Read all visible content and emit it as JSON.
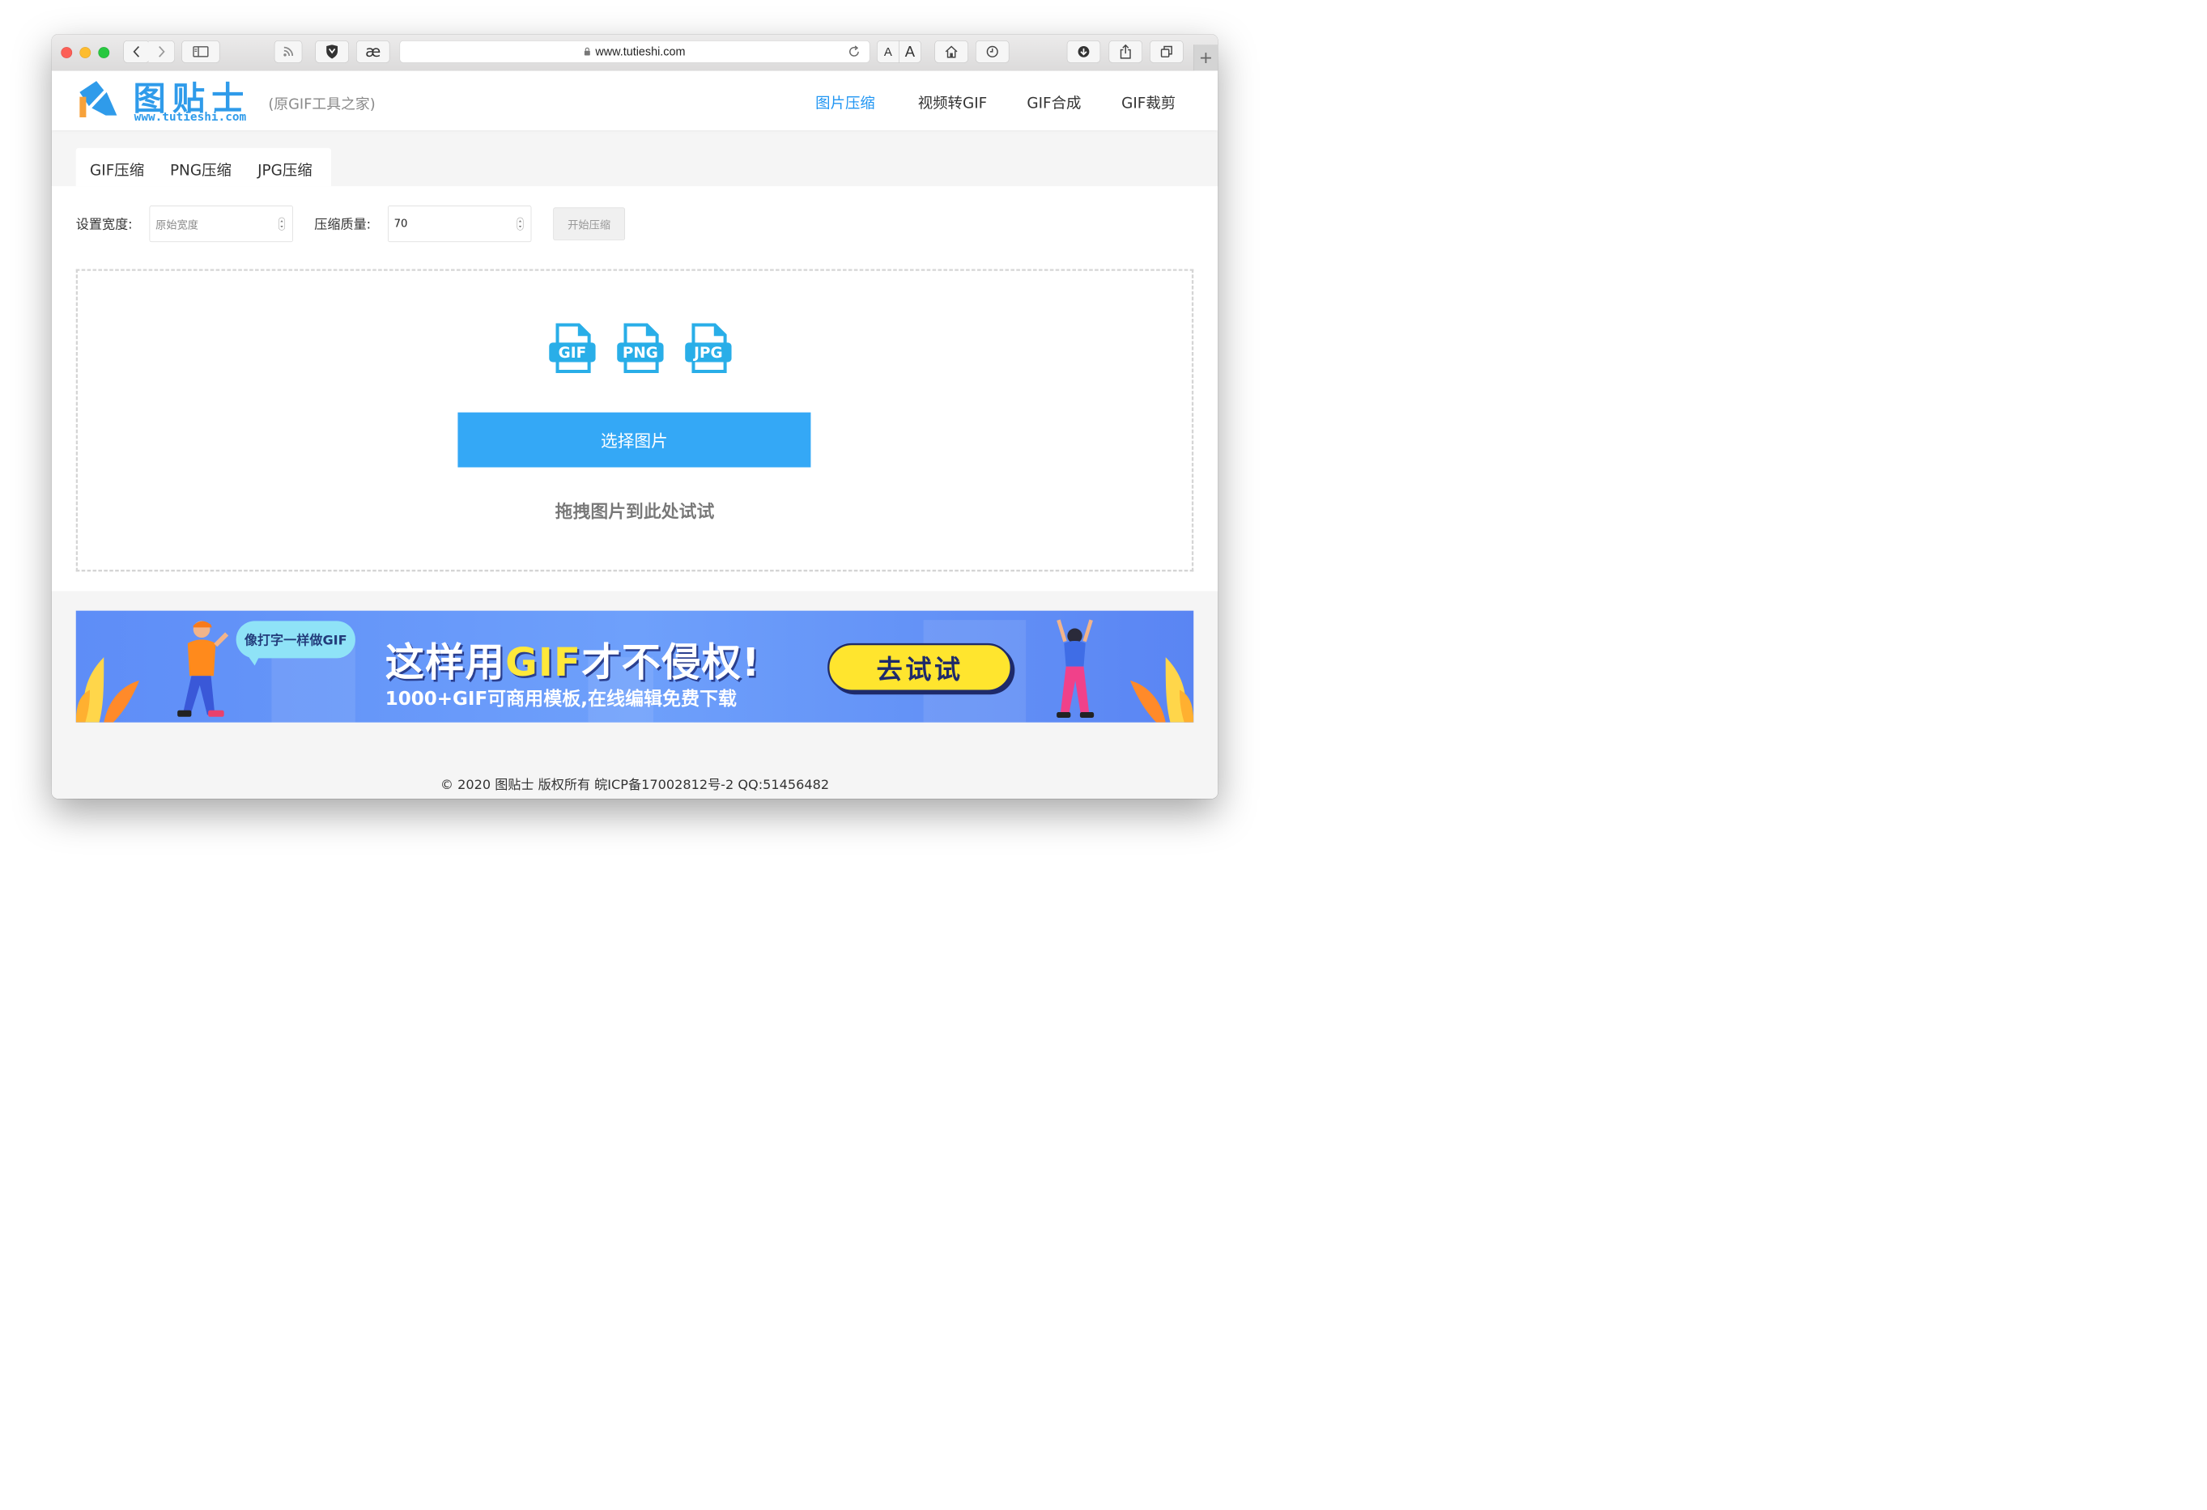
{
  "browser": {
    "url": "www.tutieshi.com",
    "text_size_small": "A",
    "text_size_large": "A"
  },
  "header": {
    "logo_text": "图贴士",
    "logo_url": "www.tutieshi.com",
    "logo_subtitle": "(原GIF工具之家)",
    "nav": [
      {
        "label": "图片压缩",
        "active": true
      },
      {
        "label": "视频转GIF",
        "active": false
      },
      {
        "label": "GIF合成",
        "active": false
      },
      {
        "label": "GIF裁剪",
        "active": false
      }
    ]
  },
  "tabs": [
    {
      "label": "GIF压缩"
    },
    {
      "label": "PNG压缩"
    },
    {
      "label": "JPG压缩"
    }
  ],
  "form": {
    "width_label": "设置宽度:",
    "width_placeholder": "原始宽度",
    "quality_label": "压缩质量:",
    "quality_value": "70",
    "start_button": "开始压缩"
  },
  "dropzone": {
    "file_types": [
      "GIF",
      "PNG",
      "JPG"
    ],
    "choose_button": "选择图片",
    "hint": "拖拽图片到此处试试"
  },
  "banner": {
    "bubble": "像打字一样做GIF",
    "title_pre": "这样用",
    "title_gif": "GIF",
    "title_post": "才不侵权!",
    "subtitle": "1000+GIF可商用模板,在线编辑免费下载",
    "cta": "去试试"
  },
  "footer": {
    "text": "© 2020 图贴士 版权所有 皖ICP备17002812号-2 QQ:51456482"
  },
  "colors": {
    "accent": "#2196f3",
    "choose_button": "#34a8f6",
    "banner_bg": "#6a98f8",
    "banner_cta": "#ffe52e"
  }
}
